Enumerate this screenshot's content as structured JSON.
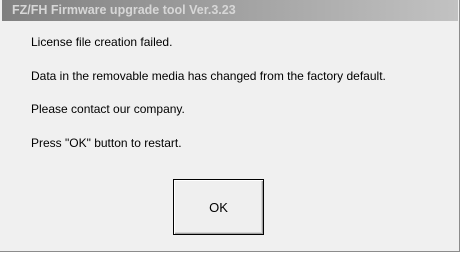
{
  "window": {
    "title": "FZ/FH Firmware upgrade tool Ver.3.23"
  },
  "message": {
    "lines": [
      "License file creation failed.",
      "Data in the removable media has changed from the factory default.",
      "Please contact our company.",
      "Press \"OK\" button to restart."
    ]
  },
  "buttons": {
    "ok_label": "OK"
  },
  "colors": {
    "dialog_background": "#f0f0f0",
    "titlebar_inactive_start": "#808080",
    "titlebar_inactive_end": "#c2c2c2",
    "title_text": "#d7d7d7"
  }
}
